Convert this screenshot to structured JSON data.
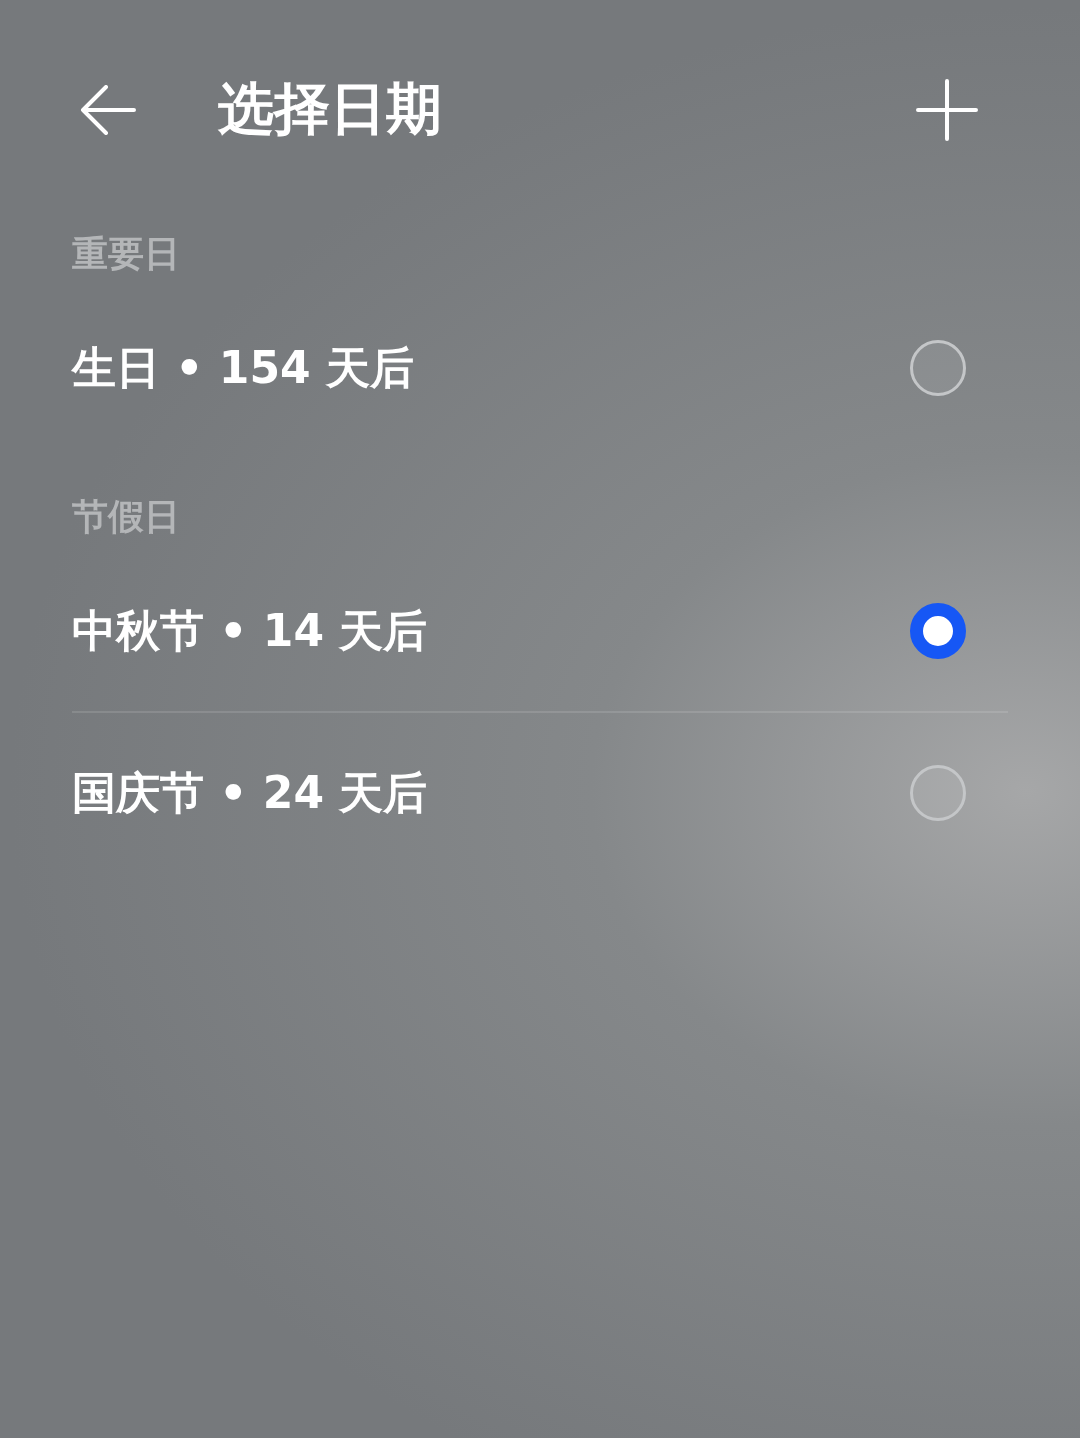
{
  "header": {
    "title": "选择日期"
  },
  "sections": [
    {
      "label": "重要日",
      "items": [
        {
          "text": "生日 • 154 天后",
          "selected": false
        }
      ]
    },
    {
      "label": "节假日",
      "items": [
        {
          "text": "中秋节 • 14 天后",
          "selected": true
        },
        {
          "text": "国庆节 • 24 天后",
          "selected": false
        }
      ]
    }
  ]
}
